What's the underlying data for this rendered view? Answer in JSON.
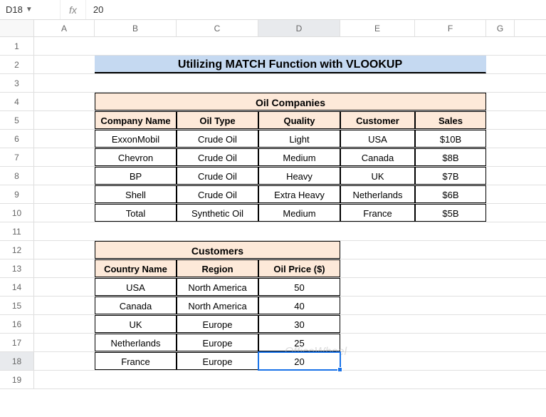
{
  "active_cell_ref": "D18",
  "fx_label": "fx",
  "formula_value": "20",
  "columns": [
    "A",
    "B",
    "C",
    "D",
    "E",
    "F",
    "G"
  ],
  "active_col": "D",
  "active_row": 18,
  "rows": [
    1,
    2,
    3,
    4,
    5,
    6,
    7,
    8,
    9,
    10,
    11,
    12,
    13,
    14,
    15,
    16,
    17,
    18,
    19
  ],
  "title": "Utilizing MATCH Function with VLOOKUP",
  "table1": {
    "header": "Oil Companies",
    "cols": [
      "Company Name",
      "Oil Type",
      "Quality",
      "Customer",
      "Sales"
    ],
    "data": [
      [
        "ExxonMobil",
        "Crude Oil",
        "Light",
        "USA",
        "$10B"
      ],
      [
        "Chevron",
        "Crude Oil",
        "Medium",
        "Canada",
        "$8B"
      ],
      [
        "BP",
        "Crude Oil",
        "Heavy",
        "UK",
        "$7B"
      ],
      [
        "Shell",
        "Crude Oil",
        "Extra Heavy",
        "Netherlands",
        "$6B"
      ],
      [
        "Total",
        "Synthetic Oil",
        "Medium",
        "France",
        "$5B"
      ]
    ]
  },
  "table2": {
    "header": "Customers",
    "cols": [
      "Country Name",
      "Region",
      "Oil Price ($)"
    ],
    "data": [
      [
        "USA",
        "North America",
        "50"
      ],
      [
        "Canada",
        "North America",
        "40"
      ],
      [
        "UK",
        "Europe",
        "30"
      ],
      [
        "Netherlands",
        "Europe",
        "25"
      ],
      [
        "France",
        "Europe",
        "20"
      ]
    ]
  },
  "watermark": "OfficeWheel",
  "chart_data": [
    {
      "type": "table",
      "title": "Oil Companies",
      "columns": [
        "Company Name",
        "Oil Type",
        "Quality",
        "Customer",
        "Sales"
      ],
      "rows": [
        [
          "ExxonMobil",
          "Crude Oil",
          "Light",
          "USA",
          "$10B"
        ],
        [
          "Chevron",
          "Crude Oil",
          "Medium",
          "Canada",
          "$8B"
        ],
        [
          "BP",
          "Crude Oil",
          "Heavy",
          "UK",
          "$7B"
        ],
        [
          "Shell",
          "Crude Oil",
          "Extra Heavy",
          "Netherlands",
          "$6B"
        ],
        [
          "Total",
          "Synthetic Oil",
          "Medium",
          "France",
          "$5B"
        ]
      ]
    },
    {
      "type": "table",
      "title": "Customers",
      "columns": [
        "Country Name",
        "Region",
        "Oil Price ($)"
      ],
      "rows": [
        [
          "USA",
          "North America",
          50
        ],
        [
          "Canada",
          "North America",
          40
        ],
        [
          "UK",
          "Europe",
          30
        ],
        [
          "Netherlands",
          "Europe",
          25
        ],
        [
          "France",
          "Europe",
          20
        ]
      ]
    }
  ]
}
